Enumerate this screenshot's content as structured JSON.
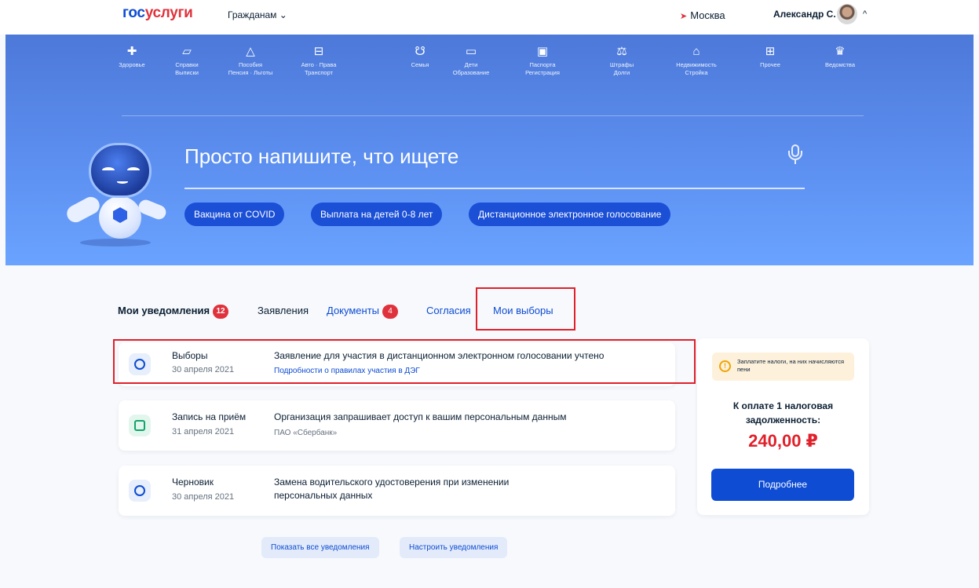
{
  "header": {
    "logo_part1": "гос",
    "logo_part2": "услуги",
    "citizens_label": "Гражданам",
    "city": "Москва",
    "user_name": "Александр С."
  },
  "categories": [
    {
      "icon": "health-icon",
      "glyph": "✚",
      "line1": "Здоровье",
      "line2": ""
    },
    {
      "icon": "folder-icon",
      "glyph": "▱",
      "line1": "Справки",
      "line2": "Выписки"
    },
    {
      "icon": "bag-icon",
      "glyph": "△",
      "line1": "Пособия",
      "line2": "Пенсия · Льготы"
    },
    {
      "icon": "car-icon",
      "glyph": "⊟",
      "line1": "Авто · Права",
      "line2": "Транспорт"
    },
    {
      "icon": "stroller-icon",
      "glyph": "☋",
      "line1": "Семья",
      "line2": ""
    },
    {
      "icon": "book-icon",
      "glyph": "▭",
      "line1": "Дети",
      "line2": "Образование"
    },
    {
      "icon": "passport-icon",
      "glyph": "▣",
      "line1": "Паспорта",
      "line2": "Регистрация"
    },
    {
      "icon": "gavel-icon",
      "glyph": "⚖",
      "line1": "Штрафы",
      "line2": "Долги"
    },
    {
      "icon": "house-icon",
      "glyph": "⌂",
      "line1": "Недвижимость",
      "line2": "Стройка"
    },
    {
      "icon": "grid-icon",
      "glyph": "⊞",
      "line1": "Прочее",
      "line2": ""
    },
    {
      "icon": "emblem-icon",
      "glyph": "♛",
      "line1": "Ведомства",
      "line2": ""
    }
  ],
  "search": {
    "prompt": "Просто напишите, что ищете"
  },
  "chips": [
    "Вакцина от COVID",
    "Выплата на детей 0-8 лет",
    "Дистанционное электронное голосование"
  ],
  "tabs": [
    {
      "label": "Мои уведомления",
      "badge": "12"
    },
    {
      "label": "Заявления",
      "badge": ""
    },
    {
      "label": "Документы",
      "badge": "4"
    },
    {
      "label": "Согласия",
      "badge": ""
    },
    {
      "label": "Мои выборы",
      "badge": ""
    }
  ],
  "notifications": [
    {
      "category": "Выборы",
      "date": "30 апреля 2021",
      "title": "Заявление для участия в дистанционном электронном голосовании учтено",
      "subtitle": "Подробности о правилах участия в ДЭГ",
      "icon": "ballot-icon",
      "icon_bg": "#e7eefc",
      "icon_color": "#0d4cd3"
    },
    {
      "category": "Запись на приём",
      "date": "31 апреля 2021",
      "title": "Организация запрашивает доступ к вашим персональным данным",
      "subtitle": "ПАО «Сбербанк»",
      "icon": "calendar-icon",
      "icon_bg": "#e3f6ee",
      "icon_color": "#13a36b"
    },
    {
      "category": "Черновик",
      "date": "30 апреля 2021",
      "title": "Замена водительского удостоверения при изменении персональных данных",
      "subtitle": "",
      "icon": "pencil-icon",
      "icon_bg": "#e7eefc",
      "icon_color": "#0d4cd3"
    }
  ],
  "taxes": {
    "warning": "Заплатите налоги, на них начисляются пени",
    "label": "К оплате 1 налоговая задолженность:",
    "amount": "240,00 ₽",
    "button": "Подробнее"
  },
  "bottom_buttons": {
    "show_all": "Показать все уведомления",
    "configure": "Настроить уведомления"
  },
  "colors": {
    "brand_blue": "#0d4cd3",
    "brand_red": "#e0323c",
    "highlight": "#e0202a"
  }
}
